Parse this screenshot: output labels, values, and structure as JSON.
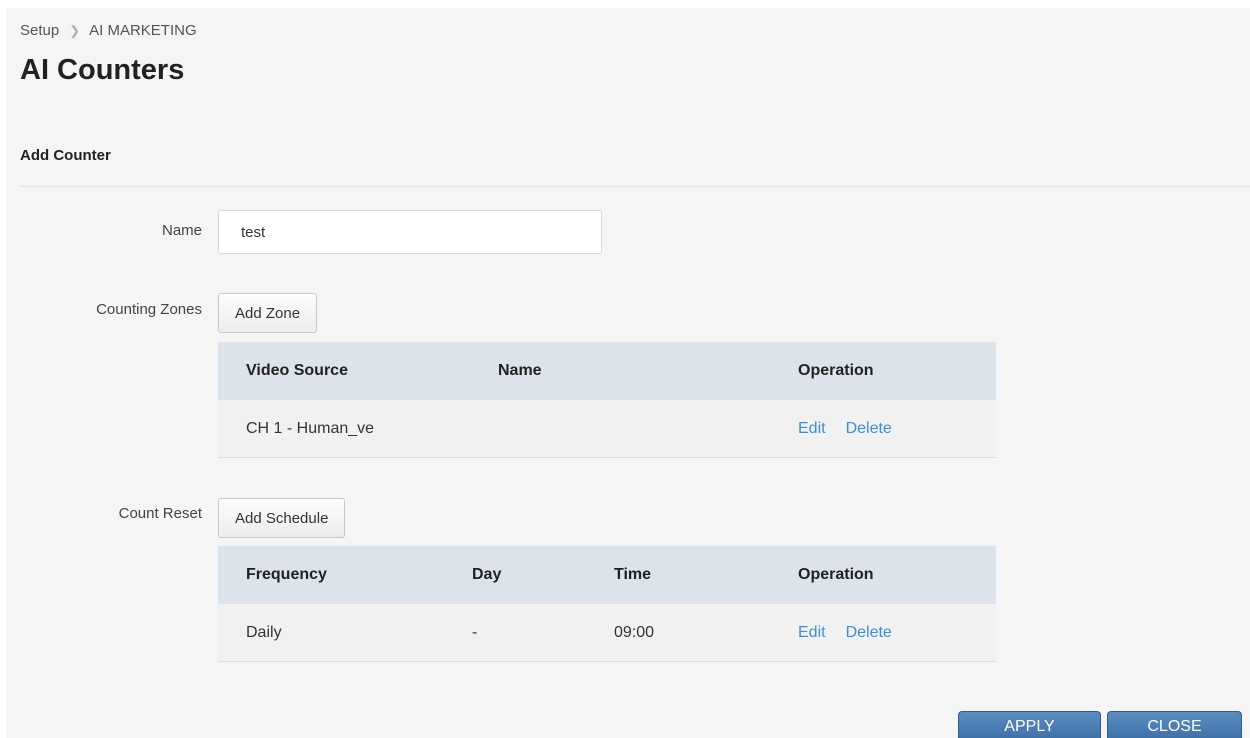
{
  "breadcrumb": {
    "root": "Setup",
    "current": "AI MARKETING"
  },
  "page_title": "AI Counters",
  "section_title": "Add Counter",
  "form": {
    "name_label": "Name",
    "name_value": "test",
    "zones_label": "Counting Zones",
    "add_zone_label": "Add Zone",
    "reset_label": "Count Reset",
    "add_schedule_label": "Add Schedule"
  },
  "zones_table": {
    "headers": [
      "Video Source",
      "Name",
      "Operation"
    ],
    "rows": [
      {
        "video_source": "CH 1 - Human_ve",
        "name": "",
        "edit": "Edit",
        "delete": "Delete"
      }
    ]
  },
  "schedule_table": {
    "headers": [
      "Frequency",
      "Day",
      "Time",
      "Operation"
    ],
    "rows": [
      {
        "frequency": "Daily",
        "day": "-",
        "time": "09:00",
        "edit": "Edit",
        "delete": "Delete"
      }
    ]
  },
  "footer": {
    "apply_label": "APPLY",
    "close_label": "CLOSE"
  },
  "colors": {
    "link": "#3a8fd8",
    "table_header": "#dde3ea",
    "primary_button": "#4a7db4",
    "page_background": "#f5f5f5"
  }
}
